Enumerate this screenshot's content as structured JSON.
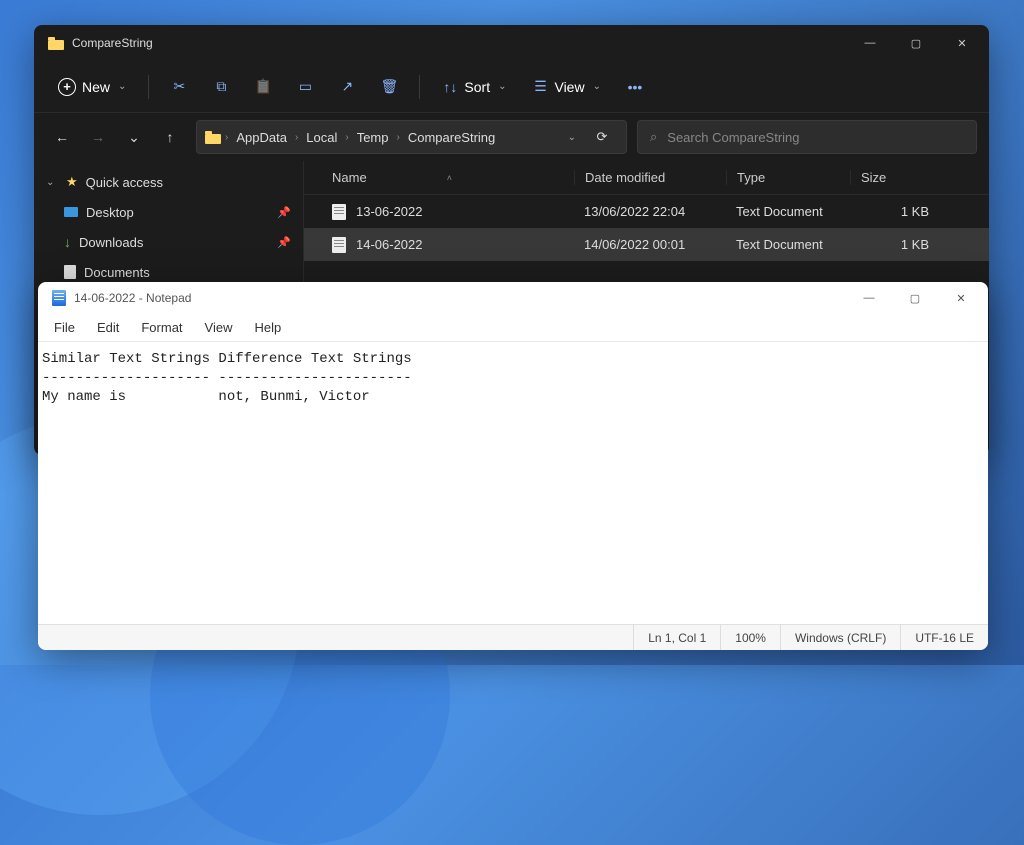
{
  "explorer": {
    "title": "CompareString",
    "toolbar": {
      "new": "New",
      "sort": "Sort",
      "view": "View"
    },
    "breadcrumbs": [
      "AppData",
      "Local",
      "Temp",
      "CompareString"
    ],
    "search_placeholder": "Search CompareString",
    "sidebar": {
      "quick_access": "Quick access",
      "desktop": "Desktop",
      "downloads": "Downloads",
      "documents": "Documents"
    },
    "columns": {
      "name": "Name",
      "date": "Date modified",
      "type": "Type",
      "size": "Size"
    },
    "files": [
      {
        "name": "13-06-2022",
        "date": "13/06/2022 22:04",
        "type": "Text Document",
        "size": "1 KB"
      },
      {
        "name": "14-06-2022",
        "date": "14/06/2022 00:01",
        "type": "Text Document",
        "size": "1 KB"
      }
    ]
  },
  "notepad": {
    "title": "14-06-2022 - Notepad",
    "menu": {
      "file": "File",
      "edit": "Edit",
      "format": "Format",
      "view": "View",
      "help": "Help"
    },
    "content": "Similar Text Strings Difference Text Strings\n-------------------- -----------------------\nMy name is           not, Bunmi, Victor",
    "status": {
      "pos": "Ln 1, Col 1",
      "zoom": "100%",
      "eol": "Windows (CRLF)",
      "enc": "UTF-16 LE"
    }
  }
}
